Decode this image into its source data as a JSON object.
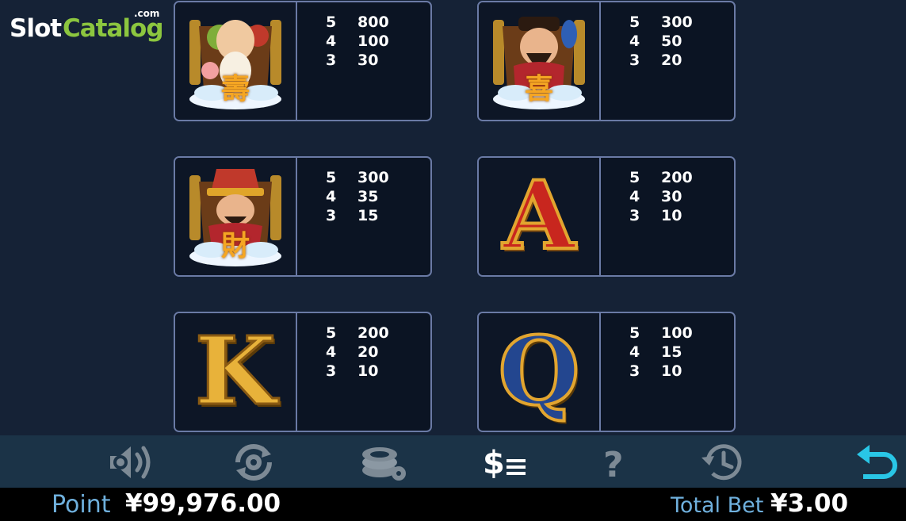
{
  "logo": {
    "part1": "Slot",
    "part2": "Catalog",
    "suffix": ".com"
  },
  "paytable": [
    {
      "symbol": "longevity-god-symbol",
      "glyph": "壽",
      "pays": [
        {
          "count": "5",
          "value": "800"
        },
        {
          "count": "4",
          "value": "100"
        },
        {
          "count": "3",
          "value": "30"
        }
      ]
    },
    {
      "symbol": "happiness-god-symbol",
      "glyph": "喜",
      "pays": [
        {
          "count": "5",
          "value": "300"
        },
        {
          "count": "4",
          "value": "50"
        },
        {
          "count": "3",
          "value": "20"
        }
      ]
    },
    {
      "symbol": "wealth-god-symbol",
      "glyph": "財",
      "pays": [
        {
          "count": "5",
          "value": "300"
        },
        {
          "count": "4",
          "value": "35"
        },
        {
          "count": "3",
          "value": "15"
        }
      ]
    },
    {
      "symbol": "letter-a-symbol",
      "glyph": "A",
      "pays": [
        {
          "count": "5",
          "value": "200"
        },
        {
          "count": "4",
          "value": "30"
        },
        {
          "count": "3",
          "value": "10"
        }
      ]
    },
    {
      "symbol": "letter-k-symbol",
      "glyph": "K",
      "pays": [
        {
          "count": "5",
          "value": "200"
        },
        {
          "count": "4",
          "value": "20"
        },
        {
          "count": "3",
          "value": "10"
        }
      ]
    },
    {
      "symbol": "letter-q-symbol",
      "glyph": "Q",
      "pays": [
        {
          "count": "5",
          "value": "100"
        },
        {
          "count": "4",
          "value": "15"
        },
        {
          "count": "3",
          "value": "10"
        }
      ]
    }
  ],
  "toolbar": {
    "icons": [
      "sound-icon",
      "autospin-icon",
      "bet-chips-icon",
      "paytable-icon",
      "help-icon",
      "history-icon",
      "back-icon"
    ],
    "active": "paytable-icon"
  },
  "footer": {
    "point_label": "Point",
    "point_value": "¥99,976.00",
    "total_bet_label": "Total Bet",
    "total_bet_value": "¥3.00"
  },
  "colors": {
    "background": "#152236",
    "card_border": "#6a7aa5",
    "accent": "#6fb0dd",
    "back_icon": "#29c6e6"
  }
}
